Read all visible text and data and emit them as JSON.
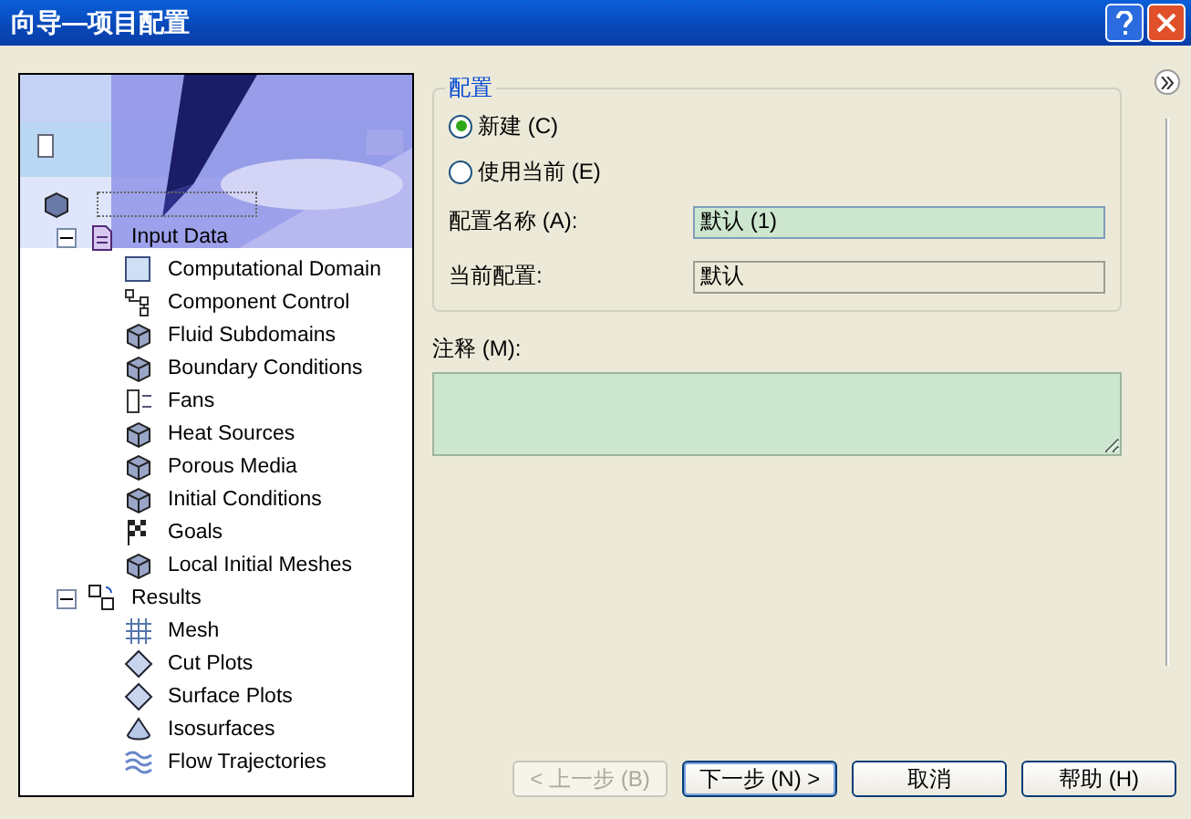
{
  "window": {
    "title": "向导—项目配置"
  },
  "tree": {
    "root": {
      "expanded": true,
      "children": [
        {
          "label": "Input Data",
          "expanded": true,
          "children": [
            {
              "label": "Computational Domain"
            },
            {
              "label": "Component Control"
            },
            {
              "label": "Fluid Subdomains"
            },
            {
              "label": "Boundary Conditions"
            },
            {
              "label": "Fans"
            },
            {
              "label": "Heat Sources"
            },
            {
              "label": "Porous Media"
            },
            {
              "label": "Initial Conditions"
            },
            {
              "label": "Goals"
            },
            {
              "label": "Local Initial Meshes"
            }
          ]
        },
        {
          "label": "Results",
          "expanded": true,
          "children": [
            {
              "label": "Mesh"
            },
            {
              "label": "Cut Plots"
            },
            {
              "label": "Surface Plots"
            },
            {
              "label": "Isosurfaces"
            },
            {
              "label": "Flow Trajectories"
            }
          ]
        }
      ]
    }
  },
  "config": {
    "legend": "配置",
    "options": [
      {
        "label": "新建 (C)",
        "selected": true
      },
      {
        "label": "使用当前 (E)",
        "selected": false
      }
    ],
    "fields": [
      {
        "label": "配置名称 (A):",
        "value": "默认 (1)",
        "editable": true
      },
      {
        "label": "当前配置:",
        "value": "默认",
        "editable": false
      }
    ]
  },
  "comment": {
    "label": "注释 (M):"
  },
  "buttons": [
    {
      "label": "< 上一步 (B)",
      "disabled": true,
      "default": false
    },
    {
      "label": "下一步 (N) >",
      "disabled": false,
      "default": true
    },
    {
      "label": "取消",
      "disabled": false,
      "default": false
    },
    {
      "label": "帮助 (H)",
      "disabled": false,
      "default": false
    }
  ]
}
